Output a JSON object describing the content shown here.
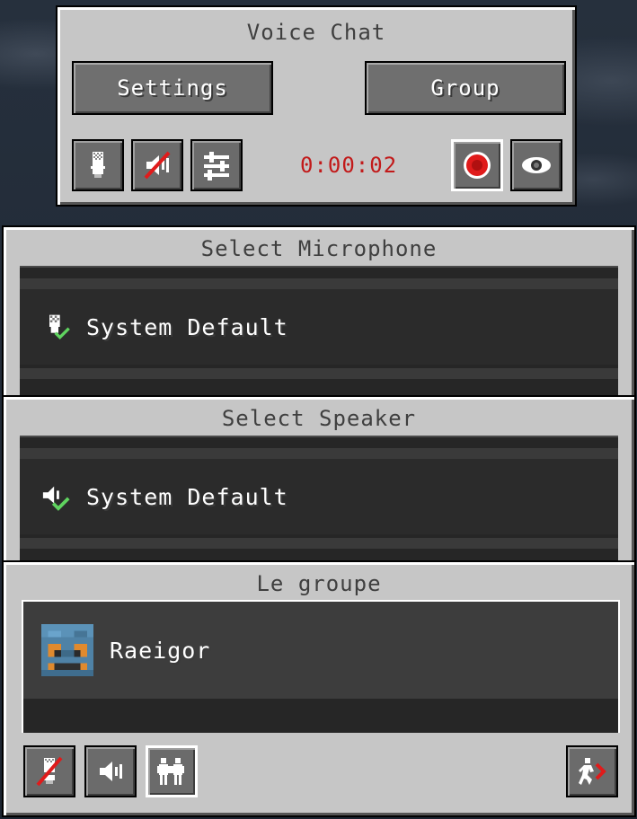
{
  "voice_chat": {
    "title": "Voice Chat",
    "settings_label": "Settings",
    "group_label": "Group",
    "timer": "0:00:02"
  },
  "microphone": {
    "title": "Select Microphone",
    "selected": "System Default"
  },
  "speaker": {
    "title": "Select Speaker",
    "selected": "System Default"
  },
  "group": {
    "title": "Le groupe",
    "members": [
      {
        "name": "Raeigor"
      }
    ]
  },
  "colors": {
    "timer": "#c21a1a",
    "record": "#e01b1b",
    "check": "#5fd35f"
  }
}
